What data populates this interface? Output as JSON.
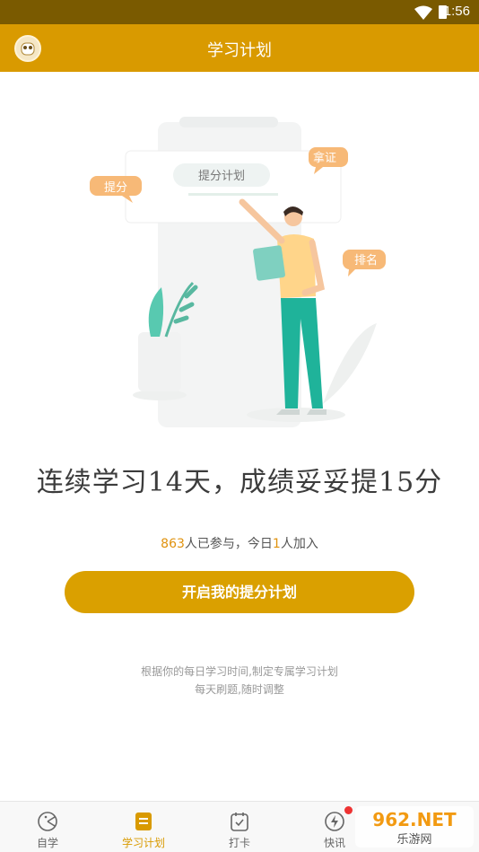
{
  "status_bar": {
    "time": "1:56"
  },
  "header": {
    "title": "学习计划"
  },
  "illustration": {
    "card_label": "提分计划",
    "bubble_left": "提分",
    "bubble_top_right": "拿证",
    "bubble_right": "排名"
  },
  "main": {
    "headline": "连续学习14天，成绩妥妥提15分",
    "participation": {
      "count": "863",
      "text1": "人已参与，今日",
      "today": "1",
      "text2": "人加入"
    },
    "cta_label": "开启我的提分计划",
    "desc_line1": "根据你的每日学习时间,制定专属学习计划",
    "desc_line2": "每天刷题,随时调整"
  },
  "tabs": [
    {
      "label": "自学",
      "icon": "pie-icon",
      "active": false
    },
    {
      "label": "学习计划",
      "icon": "plan-icon",
      "active": true
    },
    {
      "label": "打卡",
      "icon": "calendar-check-icon",
      "active": false
    },
    {
      "label": "快讯",
      "icon": "lightning-icon",
      "active": false,
      "badge": true
    },
    {
      "label": "",
      "icon": "",
      "active": false
    }
  ],
  "watermark": {
    "text": "962.NET",
    "subtext": "乐游网"
  },
  "colors": {
    "accent": "#d99a00",
    "status_bar": "#7a5a00",
    "highlight": "#e0920e",
    "figure": "#1fb39a"
  }
}
